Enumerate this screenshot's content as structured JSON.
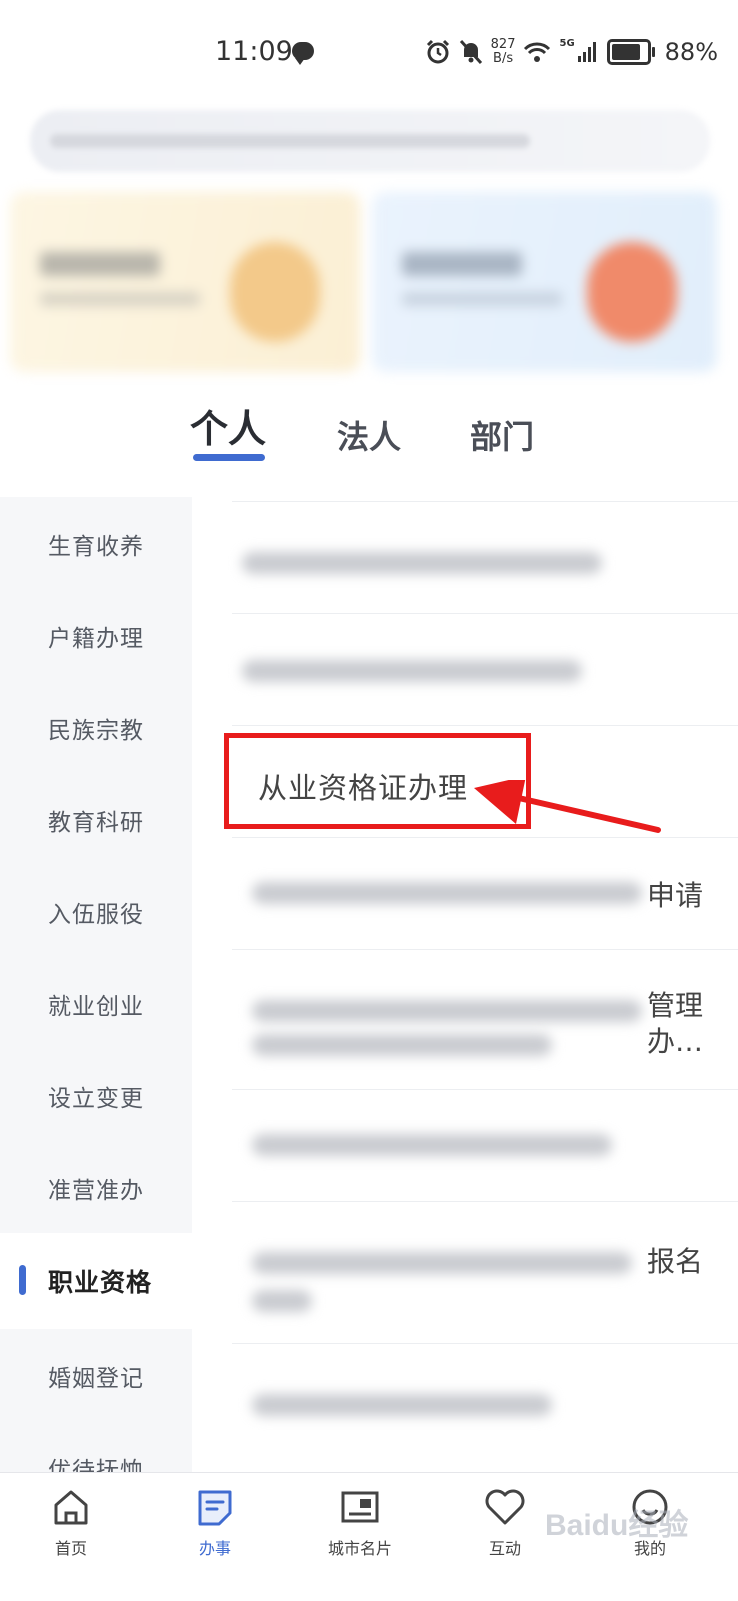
{
  "status_bar": {
    "time": "11:09",
    "net_speed_value": "827",
    "net_speed_unit": "B/s",
    "network": "5G",
    "battery": "88%",
    "icons": [
      "chat-icon",
      "alarm-icon",
      "mute-icon",
      "wifi-icon",
      "signal-icon",
      "battery-icon"
    ]
  },
  "tabs": [
    {
      "label": "个人",
      "active": true
    },
    {
      "label": "法人",
      "active": false
    },
    {
      "label": "部门",
      "active": false
    }
  ],
  "sidebar": {
    "items": [
      {
        "label": "生育收养"
      },
      {
        "label": "户籍办理"
      },
      {
        "label": "民族宗教"
      },
      {
        "label": "教育科研"
      },
      {
        "label": "入伍服役"
      },
      {
        "label": "就业创业"
      },
      {
        "label": "设立变更"
      },
      {
        "label": "准营准办"
      },
      {
        "label": "职业资格",
        "active": true
      },
      {
        "label": "婚姻登记"
      },
      {
        "label": "优待抚恤"
      }
    ]
  },
  "content": {
    "featured_item": "从业资格证办理",
    "fragments": [
      "申请",
      "管理",
      "办…",
      "报名"
    ]
  },
  "bottom_nav": [
    {
      "label": "首页",
      "icon": "home-icon"
    },
    {
      "label": "办事",
      "icon": "service-icon",
      "active": true
    },
    {
      "label": "城市名片",
      "icon": "city-card-icon"
    },
    {
      "label": "互动",
      "icon": "heart-icon"
    },
    {
      "label": "我的",
      "icon": "profile-icon"
    }
  ],
  "watermark": "Baidu经验",
  "colors": {
    "accent": "#3f6bd0",
    "annotation": "#e81c1c"
  }
}
